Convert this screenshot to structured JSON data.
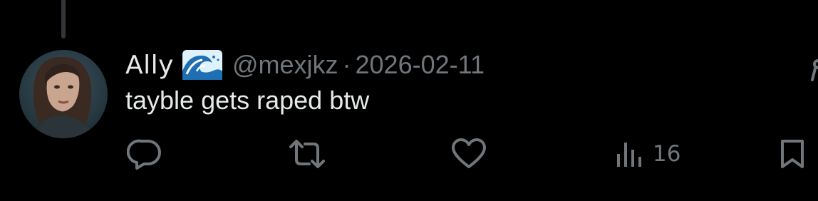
{
  "tweet": {
    "author": {
      "display_name": "Ally",
      "name_emoji_icon": "water-wave-icon",
      "handle": "@mexjkz"
    },
    "separator": "·",
    "date": "2026-02-11",
    "text": "tayble gets raped btw"
  },
  "actions": {
    "reply_icon": "speech-bubble-icon",
    "repost_icon": "repost-arrows-icon",
    "like_icon": "heart-icon",
    "views_icon": "bar-chart-icon",
    "views_count": "16",
    "bookmark_icon": "bookmark-icon"
  },
  "colors": {
    "background": "#000000",
    "primary_text": "#e7e9ea",
    "secondary_text": "#71767b",
    "thread_line": "#333639"
  }
}
